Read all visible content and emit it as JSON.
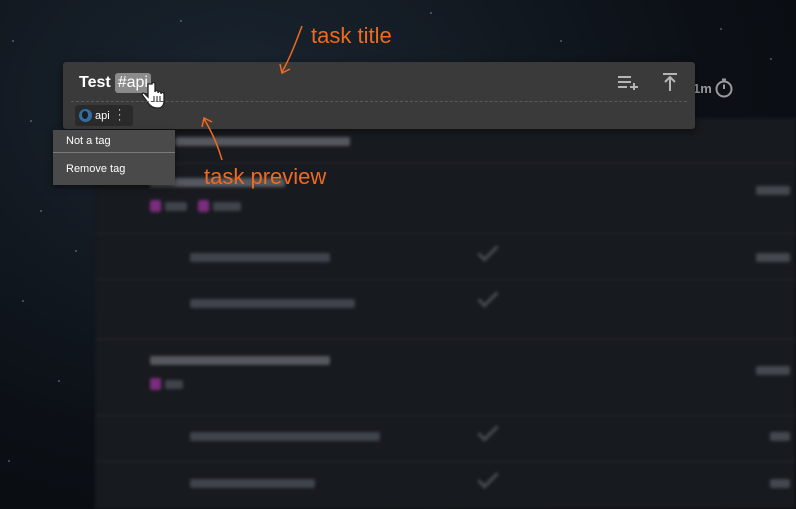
{
  "task": {
    "title": "Test",
    "tag_text": "#api"
  },
  "tag_chip": {
    "label": "api",
    "icon": "globe-icon"
  },
  "context_menu": {
    "items": [
      "Not a tag",
      "Remove tag"
    ]
  },
  "card_actions": {
    "add_subtask_icon": "add-subtask-icon",
    "move_to_top_icon": "move-to-top-icon"
  },
  "right_time": {
    "label": "1m",
    "icon": "stopwatch-icon"
  },
  "annotations": {
    "task_title": "task title",
    "task_preview": "task preview"
  },
  "colors": {
    "annotation": "#f06a1e",
    "card_bg": "#3a3a3a",
    "menu_bg": "#4a4a4a",
    "tag_purple": "#7b2d7e"
  }
}
